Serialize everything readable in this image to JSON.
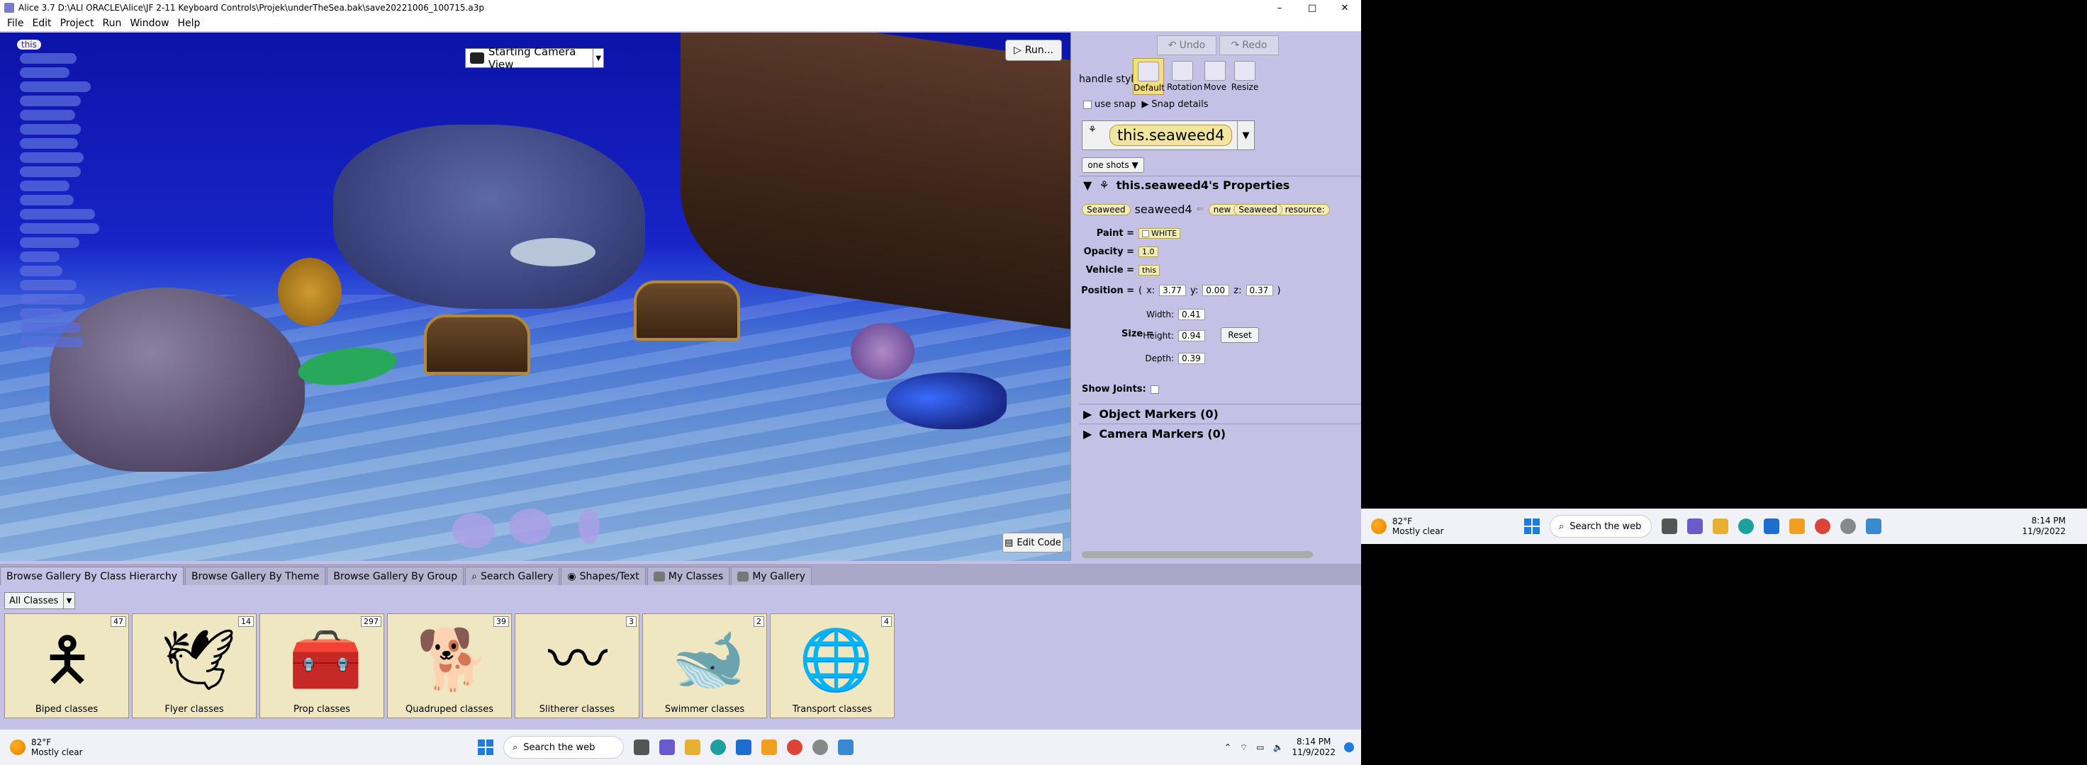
{
  "window": {
    "title": "Alice 3.7 D:\\ALI ORACLE\\Alice\\JF 2-11 Keyboard Controls\\Projek\\underTheSea.bak\\save20221006_100715.a3p",
    "minimize": "–",
    "maximize": "□",
    "close": "✕"
  },
  "menu": [
    "File",
    "Edit",
    "Project",
    "Run",
    "Window",
    "Help"
  ],
  "scene": {
    "tree_root": "this",
    "camera_view": "Starting Camera View",
    "run_label": "Run...",
    "edit_code_label": "Edit Code"
  },
  "toolbar": {
    "undo": "Undo",
    "redo": "Redo",
    "handle_style_label": "handle style:",
    "handles": [
      "Default",
      "Rotation",
      "Move",
      "Resize"
    ],
    "use_snap": "use snap",
    "snap_details": "Snap details"
  },
  "selection": {
    "object": "this.seaweed4",
    "one_shots": "one shots ▼"
  },
  "properties": {
    "header": "this.seaweed4's Properties",
    "class_name": "Seaweed",
    "instance_name": "seaweed4",
    "new_label": "new",
    "new_class": "Seaweed",
    "resource_label": "resource:",
    "paint_label": "Paint =",
    "paint_value": "WHITE",
    "opacity_label": "Opacity =",
    "opacity_value": "1.0",
    "vehicle_label": "Vehicle =",
    "vehicle_value": "this",
    "position_label": "Position =",
    "pos_x_label": "x:",
    "pos_x": "3.77",
    "pos_y_label": "y:",
    "pos_y": "0.00",
    "pos_z_label": "z:",
    "pos_z": "0.37",
    "paren_open": "(",
    "paren_close": ")",
    "size_label": "Size =",
    "width_label": "Width:",
    "width": "0.41",
    "height_label": "Height:",
    "height": "0.94",
    "depth_label": "Depth:",
    "depth": "0.39",
    "reset_label": "Reset",
    "show_joints_label": "Show Joints:",
    "object_markers": "Object Markers (0)",
    "camera_markers": "Camera Markers (0)"
  },
  "gallery": {
    "tabs": [
      "Browse Gallery By Class Hierarchy",
      "Browse Gallery By Theme",
      "Browse Gallery By Group",
      "Search Gallery",
      "Shapes/Text",
      "My Classes",
      "My Gallery"
    ],
    "filter": "All Classes",
    "cards": [
      {
        "label": "Biped classes",
        "count": "47",
        "icon": "biped-icon",
        "glyph": "🯅"
      },
      {
        "label": "Flyer classes",
        "count": "14",
        "icon": "flyer-icon",
        "glyph": "🕊"
      },
      {
        "label": "Prop classes",
        "count": "297",
        "icon": "toolbox-icon",
        "glyph": "🧰"
      },
      {
        "label": "Quadruped classes",
        "count": "39",
        "icon": "quadruped-icon",
        "glyph": "🐕"
      },
      {
        "label": "Slitherer classes",
        "count": "3",
        "icon": "slitherer-icon",
        "glyph": "〰"
      },
      {
        "label": "Swimmer classes",
        "count": "2",
        "icon": "swimmer-icon",
        "glyph": "🐋"
      },
      {
        "label": "Transport classes",
        "count": "4",
        "icon": "transport-icon",
        "glyph": "🌐"
      }
    ]
  },
  "taskbar": {
    "temp": "82°F",
    "weather": "Mostly clear",
    "search": "Search the web",
    "time": "8:14 PM",
    "date": "11/9/2022"
  },
  "taskbar2": {
    "temp": "82°F",
    "weather": "Mostly clear",
    "search": "Search the web",
    "time": "8:14 PM",
    "date": "11/9/2022"
  }
}
